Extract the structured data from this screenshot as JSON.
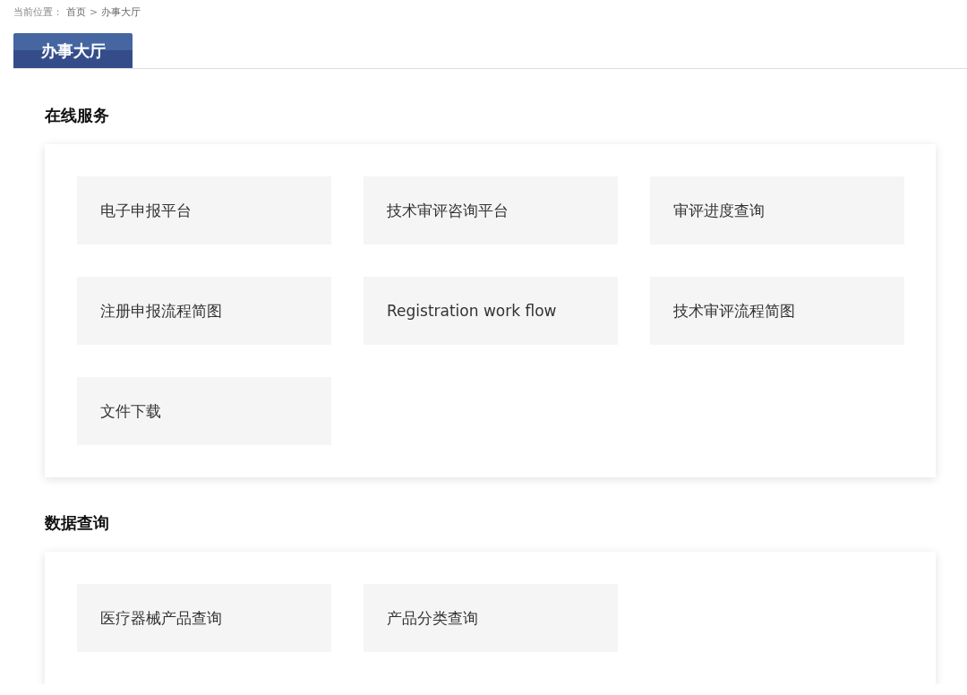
{
  "breadcrumb": {
    "label": "当前位置：",
    "items": [
      {
        "text": "首页",
        "kind": "link"
      },
      {
        "text": ">",
        "kind": "separator"
      },
      {
        "text": "办事大厅",
        "kind": "current"
      }
    ]
  },
  "tabs": [
    {
      "label": "办事大厅",
      "selected": true
    }
  ],
  "sections": [
    {
      "title": "在线服务",
      "items": [
        "电子申报平台",
        "技术审评咨询平台",
        "审评进度查询",
        "注册申报流程简图",
        "Registration work flow",
        "技术审评流程简图",
        "文件下载"
      ]
    },
    {
      "title": "数据查询",
      "items": [
        "医疗器械产品查询",
        "产品分类查询"
      ]
    }
  ]
}
